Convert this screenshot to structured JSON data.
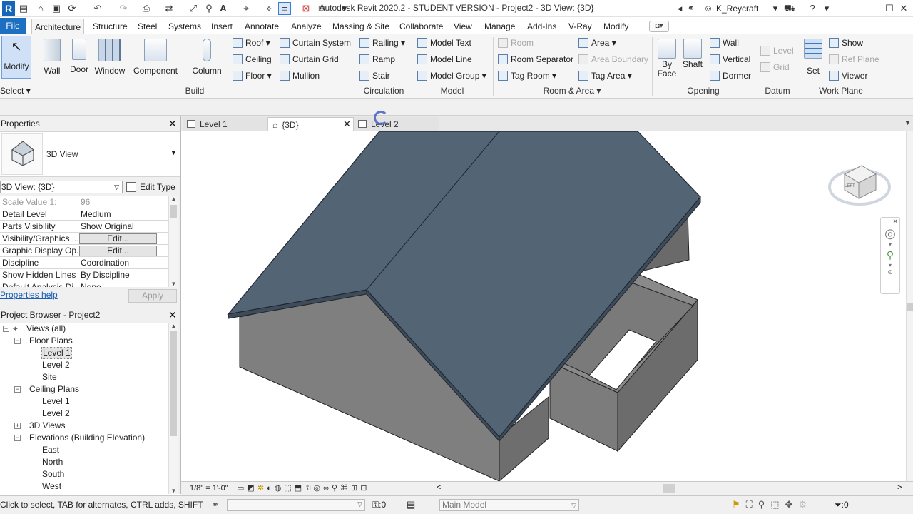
{
  "app": {
    "title": "Autodesk Revit 2020.2 - STUDENT VERSION - Project2 - 3D View: {3D}",
    "user": "K_Reycraft",
    "logo": "R"
  },
  "ribbon_tabs": [
    "File",
    "Architecture",
    "Structure",
    "Steel",
    "Systems",
    "Insert",
    "Annotate",
    "Analyze",
    "Massing & Site",
    "Collaborate",
    "View",
    "Manage",
    "Add-Ins",
    "V-Ray",
    "Modify"
  ],
  "ribbon": {
    "select": {
      "modify": "Modify",
      "label": "Select"
    },
    "build": {
      "wall": "Wall",
      "door": "Door",
      "window": "Window",
      "component": "Component",
      "column": "Column",
      "roof": "Roof",
      "ceiling": "Ceiling",
      "floor": "Floor",
      "curtain_system": "Curtain System",
      "curtain_grid": "Curtain Grid",
      "mullion": "Mullion",
      "label": "Build"
    },
    "circulation": {
      "railing": "Railing",
      "ramp": "Ramp",
      "stair": "Stair",
      "label": "Circulation"
    },
    "model": {
      "model_text": "Model Text",
      "model_line": "Model Line",
      "model_group": "Model Group",
      "label": "Model"
    },
    "room_area": {
      "room": "Room",
      "room_separator": "Room Separator",
      "tag_room": "Tag Room",
      "area": "Area",
      "area_boundary": "Area Boundary",
      "tag_area": "Tag Area",
      "label": "Room & Area"
    },
    "opening": {
      "by": "By",
      "face": "Face",
      "shaft": "Shaft",
      "wall": "Wall",
      "vertical": "Vertical",
      "dormer": "Dormer",
      "label": "Opening"
    },
    "datum": {
      "level": "Level",
      "grid": "Grid",
      "label": "Datum"
    },
    "work_plane": {
      "set": "Set",
      "show": "Show",
      "ref_plane": "Ref  Plane",
      "viewer": "Viewer",
      "label": "Work Plane"
    }
  },
  "properties": {
    "title": "Properties",
    "type_name": "3D View",
    "selector": "3D View: {3D}",
    "edit_type": "Edit Type",
    "rows": [
      {
        "name": "Scale Value    1:",
        "value": "96",
        "kind": "dim"
      },
      {
        "name": "Detail Level",
        "value": "Medium",
        "kind": "text"
      },
      {
        "name": "Parts Visibility",
        "value": "Show Original",
        "kind": "text"
      },
      {
        "name": "Visibility/Graphics ...",
        "value": "Edit...",
        "kind": "button"
      },
      {
        "name": "Graphic Display Op...",
        "value": "Edit...",
        "kind": "button"
      },
      {
        "name": "Discipline",
        "value": "Coordination",
        "kind": "text"
      },
      {
        "name": "Show Hidden Lines",
        "value": "By Discipline",
        "kind": "text"
      },
      {
        "name": "Default Analysis Di...",
        "value": "None",
        "kind": "text"
      }
    ],
    "help": "Properties help",
    "apply": "Apply"
  },
  "browser": {
    "title": "Project Browser - Project2",
    "items": [
      {
        "label": "Views (all)",
        "level": 0,
        "toggle": "−",
        "icon": true
      },
      {
        "label": "Floor Plans",
        "level": 1,
        "toggle": "−"
      },
      {
        "label": "Level 1",
        "level": 2,
        "selected": true
      },
      {
        "label": "Level 2",
        "level": 2
      },
      {
        "label": "Site",
        "level": 2
      },
      {
        "label": "Ceiling Plans",
        "level": 1,
        "toggle": "−"
      },
      {
        "label": "Level 1",
        "level": 2
      },
      {
        "label": "Level 2",
        "level": 2
      },
      {
        "label": "3D Views",
        "level": 1,
        "toggle": "+"
      },
      {
        "label": "Elevations (Building Elevation)",
        "level": 1,
        "toggle": "−"
      },
      {
        "label": "East",
        "level": 2
      },
      {
        "label": "North",
        "level": 2
      },
      {
        "label": "South",
        "level": 2
      },
      {
        "label": "West",
        "level": 2
      }
    ]
  },
  "view_tabs": [
    {
      "label": "Level 1",
      "active": false
    },
    {
      "label": "{3D}",
      "active": true
    },
    {
      "label": "Level 2",
      "active": false
    }
  ],
  "viewcube_label": "LEFT",
  "view_scale": "1/8\" = 1'-0\"",
  "status": {
    "hint": "Click to select, TAB for alternates, CTRL adds, SHIFT unselec",
    "workset_count": ":0",
    "model": "Main Model",
    "filter_count": ":0"
  },
  "colors": {
    "roof": "#536475",
    "wall": "#7f7f7f",
    "accent": "#1d6fc2"
  }
}
